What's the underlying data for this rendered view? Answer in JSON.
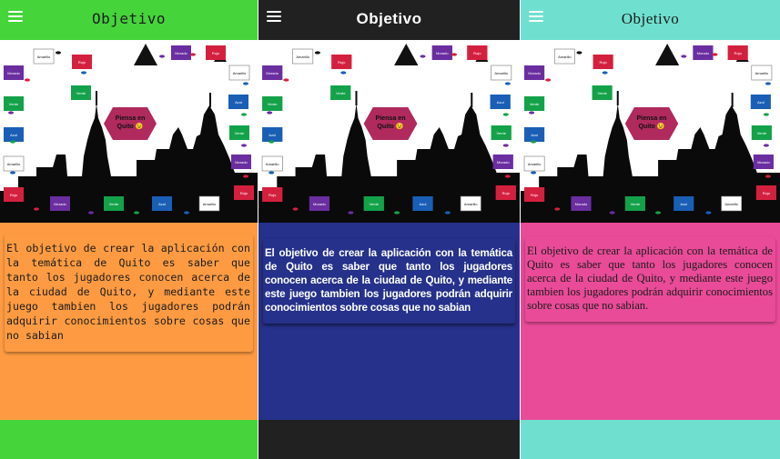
{
  "screens": [
    {
      "title": "Objetivo",
      "body": "El objetivo de crear la aplicación con la temática de Quito es saber que tanto los jugadores conocen acerca de la ciudad de Quito, y mediante este juego tambien los jugadores podrán adquirir conocimientos sobre cosas que no sabian",
      "colors": {
        "header": "#45d43a",
        "content": "#fe9b42",
        "footer": "#45d43a"
      }
    },
    {
      "title": "Objetivo",
      "body": "El objetivo de crear la aplicación con la temática de Quito es saber que tanto los jugadores conocen acerca de la ciudad de Quito, y mediante este juego tambien los jugadores podrán adquirir conocimientos sobre cosas que no sabian",
      "colors": {
        "header": "#212121",
        "content": "#25318a",
        "footer": "#212121"
      }
    },
    {
      "title": "Objetivo",
      "body": "El objetivo de crear la aplicación con la temática de Quito es saber que tanto los jugadores conocen acerca de la ciudad de Quito, y mediante este juego tambien los jugadores podrán adquirir conocimientos sobre cosas que no sabian.",
      "colors": {
        "header": "#6fe0cf",
        "content": "#e94b98",
        "footer": "#6fe0cf"
      }
    }
  ],
  "board": {
    "center_label": "Piensa en Quito 😉",
    "squares": [
      {
        "label": "Amarillo",
        "color": "#ffffff"
      },
      {
        "label": "Rojo",
        "color": "#d4203f"
      },
      {
        "label": "Morado",
        "color": "#6a2ea0"
      },
      {
        "label": "Verde",
        "color": "#13a24a"
      },
      {
        "label": "Azul",
        "color": "#1a5fb5"
      },
      {
        "label": "Amarillo",
        "color": "#ffffff"
      },
      {
        "label": "Rojo",
        "color": "#d4203f"
      },
      {
        "label": "Morado",
        "color": "#6a2ea0"
      },
      {
        "label": "Verde",
        "color": "#13a24a"
      },
      {
        "label": "Azul",
        "color": "#1a5fb5"
      },
      {
        "label": "Amarillo",
        "color": "#ffffff"
      },
      {
        "label": "Rojo",
        "color": "#d4203f"
      },
      {
        "label": "Morado",
        "color": "#6a2ea0"
      },
      {
        "label": "Verde",
        "color": "#13a24a"
      },
      {
        "label": "Azul",
        "color": "#1a5fb5"
      },
      {
        "label": "Amarillo",
        "color": "#ffffff"
      },
      {
        "label": "Rojo",
        "color": "#d4203f"
      },
      {
        "label": "Morado",
        "color": "#6a2ea0"
      },
      {
        "label": "Verde",
        "color": "#13a24a"
      },
      {
        "label": "Azul",
        "color": "#1a5fb5"
      },
      {
        "label": "Amarillo",
        "color": "#ffffff"
      },
      {
        "label": "Inicio",
        "color": "#111111"
      }
    ]
  },
  "icons": {
    "menu": "hamburger-menu-icon"
  }
}
